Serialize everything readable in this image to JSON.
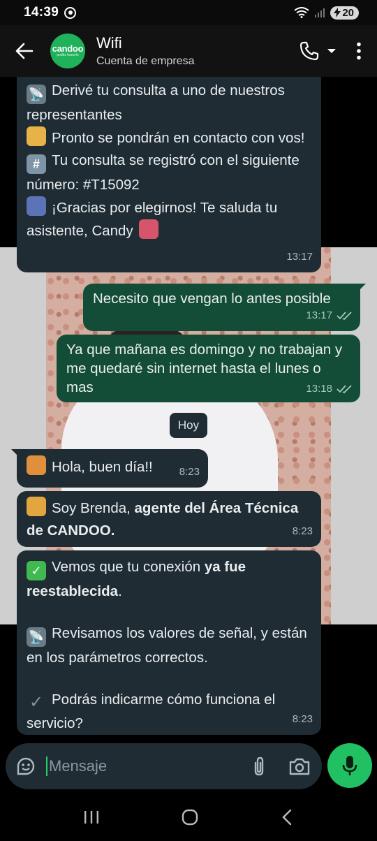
{
  "status_bar": {
    "time": "14:39",
    "battery": "20"
  },
  "header": {
    "title": "Wifi",
    "subtitle": "Cuenta de empresa",
    "avatar_logo": "candoo",
    "avatar_tagline": "podés hacerlo"
  },
  "day_divider": "Hoy",
  "messages": [
    {
      "side": "in",
      "lines": [
        {
          "emoji": "satellite-icon",
          "text": "Derivé tu consulta a uno de nuestros representantes"
        },
        {
          "emoji": "person-icon",
          "text": "Pronto se pondrán en contacto con vos!"
        },
        {
          "emoji": "hash-icon",
          "text": "Tu consulta se registró con el siguiente número: #T15092"
        },
        {
          "emoji": "people-icon",
          "text": "¡Gracias por elegirnos! Te saluda tu asistente, Candy"
        }
      ],
      "time": "13:17"
    },
    {
      "side": "out",
      "text": "Necesito que vengan lo antes posible",
      "time": "13:17"
    },
    {
      "side": "out",
      "text": "Ya que mañana es domingo y no trabajan y me quedaré sin internet hasta el lunes o mas",
      "time": "13:18"
    },
    {
      "side": "in",
      "emoji": "waving-person-icon",
      "text": "Hola, buen día!!",
      "time": "8:23"
    },
    {
      "side": "in",
      "emoji": "technician-icon",
      "text_plain": "Soy Brenda, ",
      "text_bold": "agente del Área Técnica de CANDOO.",
      "time": "8:23"
    },
    {
      "side": "in",
      "time": "8:23",
      "p1_plain": "Vemos que tu conexión ",
      "p1_bold": "ya fue reestablecida",
      "p1_end": ".",
      "p2": "Revisamos los valores de señal, y están en los parámetros correctos.",
      "p3": "Podrás indicarme cómo funciona el servicio?"
    }
  ],
  "composer": {
    "placeholder": "Mensaje"
  },
  "colors": {
    "incoming": "#1f2c33",
    "outgoing": "#144d37",
    "accent": "#21c063"
  }
}
